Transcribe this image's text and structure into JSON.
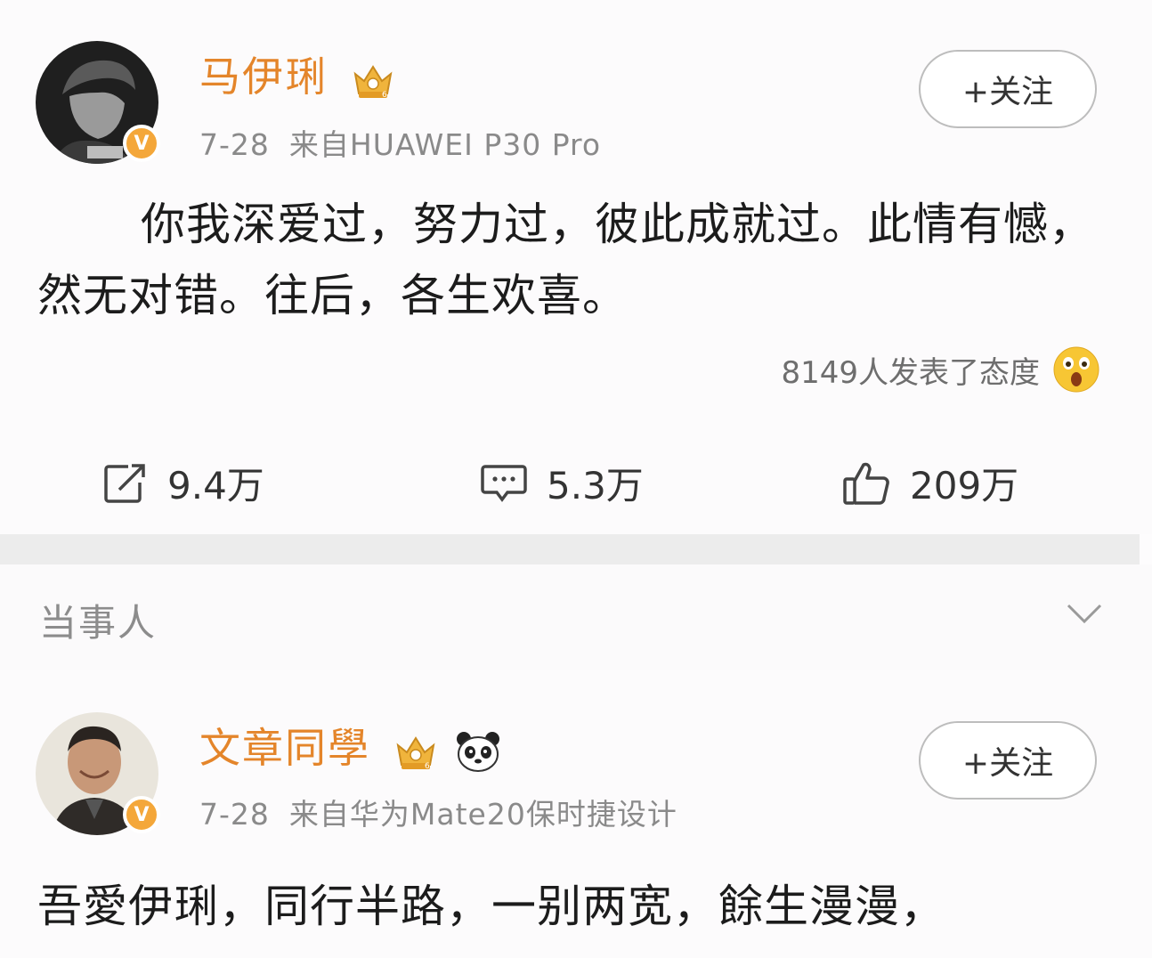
{
  "post1": {
    "author": "马伊琍",
    "date": "7-28",
    "source": "来自HUAWEI P30 Pro",
    "follow_label": "+关注",
    "content": "你我深爱过，努力过，彼此成就过。此情有憾，然无对错。往后，各生欢喜。",
    "attitude_text": "8149人发表了态度",
    "reposts": "9.4万",
    "comments": "5.3万",
    "likes": "209万",
    "verified_badge": "V"
  },
  "section": {
    "title": "当事人"
  },
  "post2": {
    "author": "文章同學",
    "date": "7-28",
    "source": "来自华为Mate20保时捷设计",
    "follow_label": "+关注",
    "content": "吾愛伊琍，同行半路，一别两宽，餘生漫漫，",
    "verified_badge": "V"
  },
  "icons": {
    "crown": "crown-badge-icon",
    "panda": "panda-icon",
    "surprised": "surprised-emoji-icon",
    "repost": "repost-icon",
    "comment": "comment-icon",
    "like": "thumbs-up-icon",
    "chevron": "chevron-down-icon"
  },
  "colors": {
    "name": "#e4852a",
    "badge": "#f4a73a",
    "meta": "#8a8a8a"
  }
}
